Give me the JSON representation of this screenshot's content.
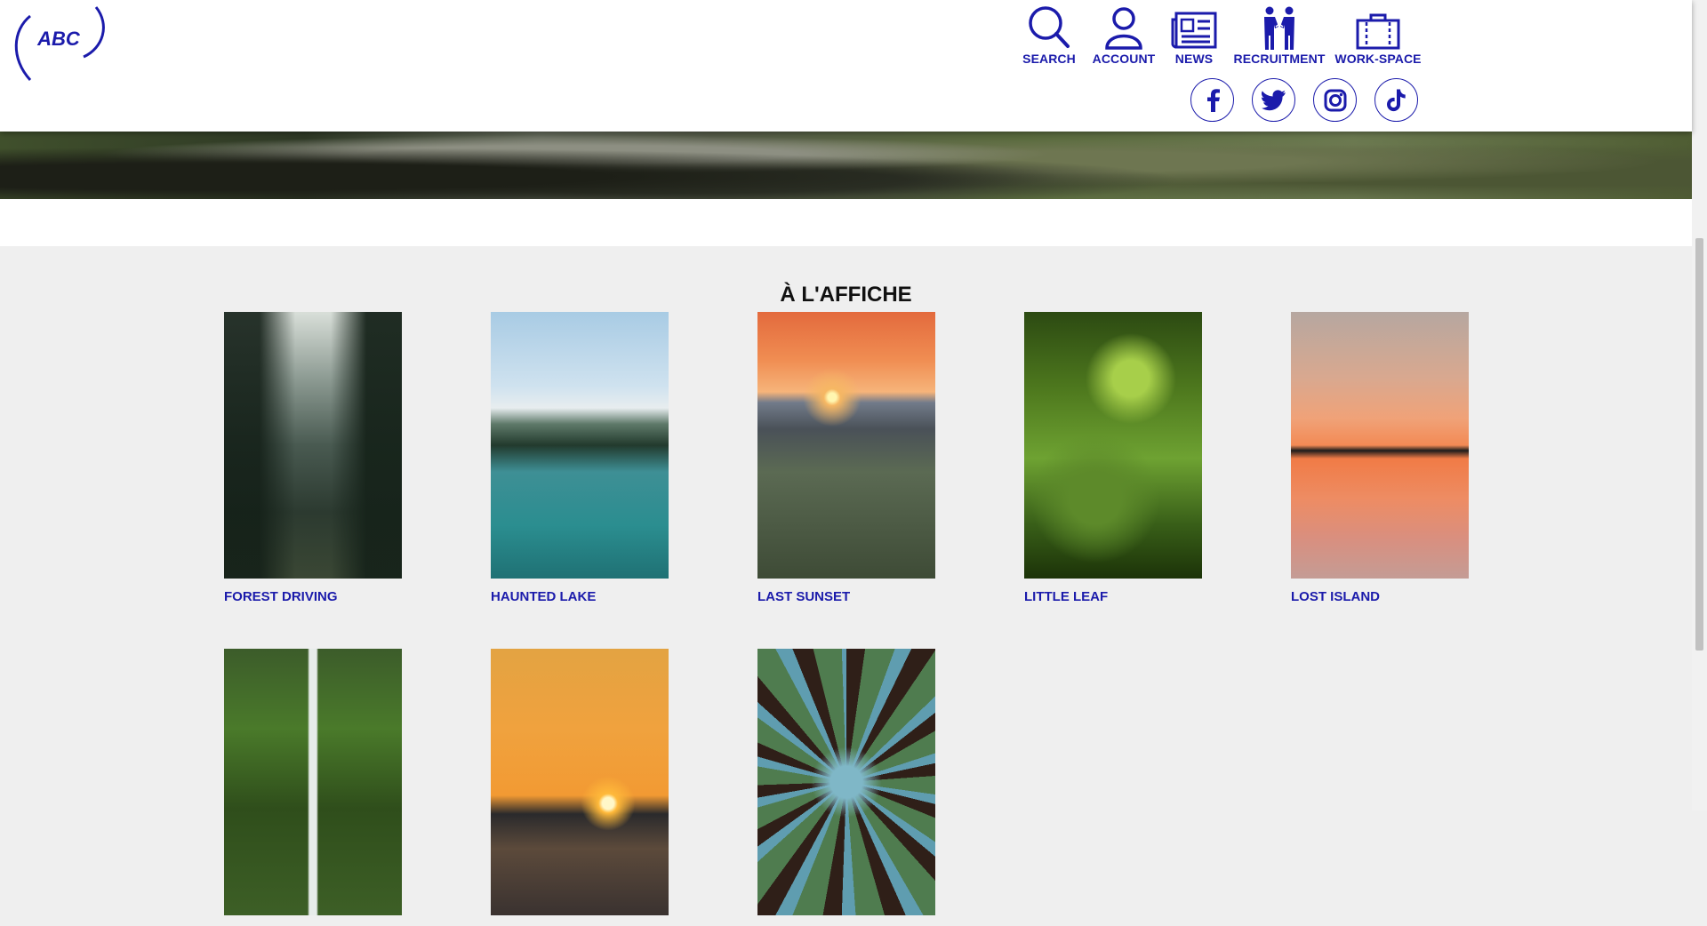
{
  "header": {
    "logo_text": "ABC",
    "nav": [
      {
        "label": "SEARCH",
        "icon": "search-icon"
      },
      {
        "label": "ACCOUNT",
        "icon": "account-icon"
      },
      {
        "label": "NEWS",
        "icon": "news-icon"
      },
      {
        "label": "RECRUITMENT",
        "icon": "handshake-icon"
      },
      {
        "label": "WORK-SPACE",
        "icon": "briefcase-icon"
      }
    ],
    "social": [
      "facebook-icon",
      "twitter-icon",
      "instagram-icon",
      "tiktok-icon"
    ]
  },
  "featured": {
    "title": "À L'AFFICHE",
    "items": [
      {
        "label": "FOREST DRIVING"
      },
      {
        "label": "HAUNTED LAKE"
      },
      {
        "label": "LAST SUNSET"
      },
      {
        "label": "LITTLE LEAF"
      },
      {
        "label": "LOST ISLAND"
      },
      {
        "label": ""
      },
      {
        "label": ""
      },
      {
        "label": ""
      }
    ]
  },
  "colors": {
    "accent": "#1b1bab",
    "background": "#efefef"
  }
}
